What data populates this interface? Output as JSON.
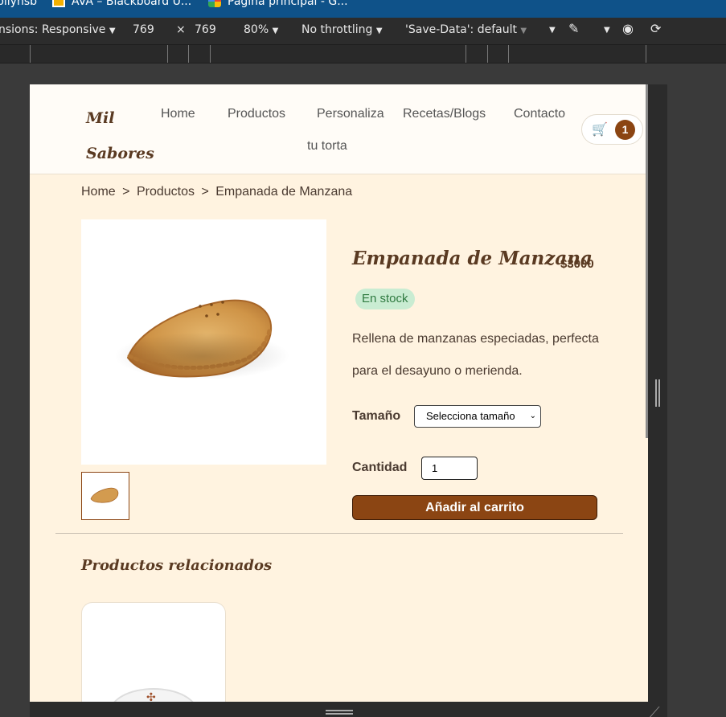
{
  "browser": {
    "bookmarks": [
      {
        "label": "biiyhsb"
      },
      {
        "label": "AVA – Blackboard U..."
      },
      {
        "label": "Página principal - G..."
      }
    ],
    "devtools": {
      "dimensions": "nsions: Responsive",
      "width": "769",
      "times": "×",
      "height": "769",
      "zoom": "80%",
      "throttling": "No throttling",
      "save_data": "'Save-Data': default"
    }
  },
  "site": {
    "logo_line1": "Mil",
    "logo_line2": "Sabores",
    "nav": {
      "home": "Home",
      "productos": "Productos",
      "personaliza_line1": "Personaliza",
      "personaliza_line2": "tu torta",
      "recetas": "Recetas/Blogs",
      "contacto": "Contacto"
    },
    "cart_count": "1"
  },
  "breadcrumb": {
    "home": "Home",
    "sep1": ">",
    "productos": "Productos",
    "sep2": ">",
    "current": "Empanada de Manzana"
  },
  "product": {
    "title": "Empanada de Manzana",
    "price": "$3000",
    "stock": "En stock",
    "description": "Rellena de manzanas especiadas, perfecta para el desayuno o merienda.",
    "size_label": "Tamaño",
    "size_value": "Selecciona tamaño",
    "qty_label": "Cantidad",
    "qty_value": "1",
    "add_button": "Añadir al carrito"
  },
  "related": {
    "title": "Productos relacionados"
  }
}
